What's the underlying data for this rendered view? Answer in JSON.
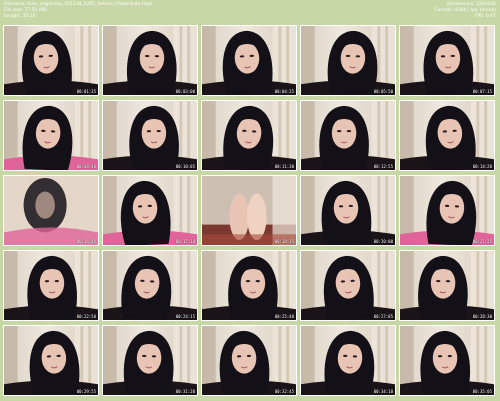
{
  "header": {
    "filename": "Filename: miss_angelinna_261218_2205_female_Chaturbate.mp4",
    "filesize": "File size: 77.52 MiB",
    "length": "Length: 35:10",
    "dimensions": "Dimensions: 320x240",
    "format": "Format: H264 / aac (mono)",
    "fps": "FPS: 6.67"
  },
  "thumbnails": [
    {
      "time": "00:01:35",
      "scene": "face"
    },
    {
      "time": "00:03:00",
      "scene": "face"
    },
    {
      "time": "00:04:25",
      "scene": "face"
    },
    {
      "time": "00:05:50",
      "scene": "face"
    },
    {
      "time": "00:07:15",
      "scene": "face"
    },
    {
      "time": "00:08:40",
      "scene": "face"
    },
    {
      "time": "00:10:05",
      "scene": "face"
    },
    {
      "time": "00:11:30",
      "scene": "face"
    },
    {
      "time": "00:12:55",
      "scene": "face"
    },
    {
      "time": "00:14:20",
      "scene": "face"
    },
    {
      "time": "00:15:45",
      "scene": "blur"
    },
    {
      "time": "00:17:10",
      "scene": "face"
    },
    {
      "time": "00:18:35",
      "scene": "legs"
    },
    {
      "time": "00:20:00",
      "scene": "face"
    },
    {
      "time": "00:21:25",
      "scene": "face"
    },
    {
      "time": "00:22:50",
      "scene": "face"
    },
    {
      "time": "00:24:15",
      "scene": "face"
    },
    {
      "time": "00:25:40",
      "scene": "face"
    },
    {
      "time": "00:27:05",
      "scene": "face"
    },
    {
      "time": "00:28:30",
      "scene": "face"
    },
    {
      "time": "00:29:55",
      "scene": "face"
    },
    {
      "time": "00:31:20",
      "scene": "face"
    },
    {
      "time": "00:32:45",
      "scene": "face"
    },
    {
      "time": "00:34:10",
      "scene": "face"
    },
    {
      "time": "00:35:05",
      "scene": "face"
    }
  ],
  "colors": {
    "sheet_background": "#c7d7a6",
    "hair": "#141018",
    "skin": "#e8c4b4",
    "top_pink": "#e0649a"
  }
}
